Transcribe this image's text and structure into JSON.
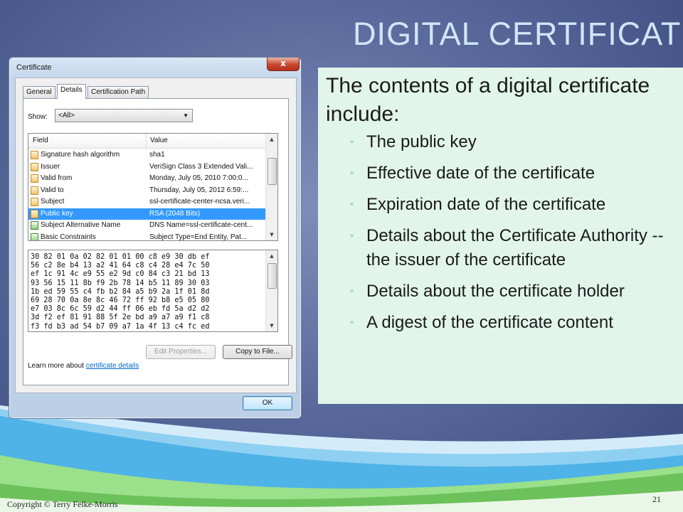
{
  "slide": {
    "title": "DIGITAL CERTIFICATE",
    "copyright": "Copyright © Terry Felke-Morris",
    "page_number": "21"
  },
  "dialog": {
    "title": "Certificate",
    "close_label": "x",
    "tabs": [
      {
        "label": "General",
        "active": false
      },
      {
        "label": "Details",
        "active": true
      },
      {
        "label": "Certification Path",
        "active": false
      }
    ],
    "show_label": "Show:",
    "show_value": "<All>",
    "columns": {
      "field": "Field",
      "value": "Value"
    },
    "rows": [
      {
        "field": "Signature hash algorithm",
        "value": "sha1",
        "selected": false
      },
      {
        "field": "Issuer",
        "value": "VeriSign Class 3 Extended Vali...",
        "selected": false
      },
      {
        "field": "Valid from",
        "value": "Monday, July 05, 2010 7:00:0...",
        "selected": false
      },
      {
        "field": "Valid to",
        "value": "Thursday, July 05, 2012 6:59:...",
        "selected": false
      },
      {
        "field": "Subject",
        "value": "ssl-certificate-center-ncsa.veri...",
        "selected": false
      },
      {
        "field": "Public key",
        "value": "RSA (2048 Bits)",
        "selected": true
      },
      {
        "field": "Subject Alternative Name",
        "value": "DNS Name=ssl-certificate-cent...",
        "selected": false
      },
      {
        "field": "Basic Constraints",
        "value": "Subject Type=End Entity, Pat...",
        "selected": false
      }
    ],
    "hex_lines": [
      "30 82 01 0a 02 82 01 01 00 c8 e9 30 db ef",
      "56 c2 8e b4 13 a2 41 64 c8 c4 28 e4 7c 50",
      "ef 1c 91 4c e9 55 e2 9d c0 84 c3 21 bd 13",
      "93 56 15 11 8b f9 2b 78 14 b5 11 89 30 03",
      "1b ed 59 55 c4 fb b2 84 a5 b9 2a 1f 01 8d",
      "69 28 70 0a 8e 8c 46 72 ff 92 b8 e5 05 80",
      "e7 03 8c 6c 59 d2 44 ff 06 eb fd 5a d2 d2",
      "3d f2 ef 81 91 88 5f 2e bd a9 a7 a9 f1 c8",
      "f3 fd b3 ad 54 b7 09 a7 1a 4f 13 c4 fc ed"
    ],
    "edit_properties_label": "Edit Properties...",
    "copy_to_file_label": "Copy to File...",
    "learn_more_text": "Learn more about ",
    "learn_more_link": "certificate details",
    "ok_label": "OK"
  },
  "content": {
    "intro": "The contents of a digital certificate include:",
    "bullets": [
      "The public key",
      "Effective date of the certificate",
      "Expiration date of the certificate",
      "Details about the Certificate Authority -- the issuer of the certificate",
      "Details about the certificate holder",
      "A digest of the certificate content"
    ]
  }
}
